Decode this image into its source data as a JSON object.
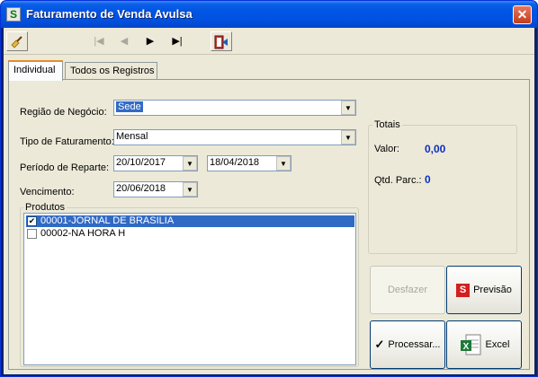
{
  "window": {
    "title": "Faturamento de Venda Avulsa",
    "app_icon_glyph": "S",
    "close_glyph": "✕"
  },
  "toolbar": {
    "buttons": [
      {
        "name": "broom-icon",
        "glyph": "🧹",
        "enabled": true
      },
      {
        "name": "first-record-icon",
        "glyph": "|◀",
        "enabled": false
      },
      {
        "name": "prev-record-icon",
        "glyph": "◀",
        "enabled": false
      },
      {
        "name": "next-record-icon",
        "glyph": "▶",
        "enabled": true
      },
      {
        "name": "last-record-icon",
        "glyph": "▶|",
        "enabled": true
      },
      {
        "name": "exit-icon",
        "glyph": "⇥",
        "enabled": true
      }
    ]
  },
  "tabs": [
    {
      "label": "Individual",
      "active": true
    },
    {
      "label": "Todos os Registros",
      "active": false
    }
  ],
  "form": {
    "regiao": {
      "label": "Região de Negócio:",
      "value": "Sede"
    },
    "tipo": {
      "label": "Tipo de Faturamento:",
      "value": "Mensal"
    },
    "periodo": {
      "label": "Período de Reparte:",
      "from": "20/10/2017",
      "to": "18/04/2018"
    },
    "vencimento": {
      "label": "Vencimento:",
      "value": "20/06/2018"
    }
  },
  "produtos": {
    "title": "Produtos",
    "items": [
      {
        "label": "00001-JORNAL DE BRASILIA",
        "checked": true,
        "selected": true
      },
      {
        "label": "00002-NA HORA H",
        "checked": false,
        "selected": false
      }
    ]
  },
  "totais": {
    "title": "Totais",
    "valor_label": "Valor:",
    "valor": "0,00",
    "parc_label": "Qtd. Parc.:",
    "parc": "0"
  },
  "buttons": {
    "desfazer": "Desfazer",
    "previsao": "Previsão",
    "processar": "Processar...",
    "excel": "Excel"
  },
  "colors": {
    "accent": "#0054e3",
    "selection": "#316ac5",
    "value_blue": "#0d2ec2"
  }
}
